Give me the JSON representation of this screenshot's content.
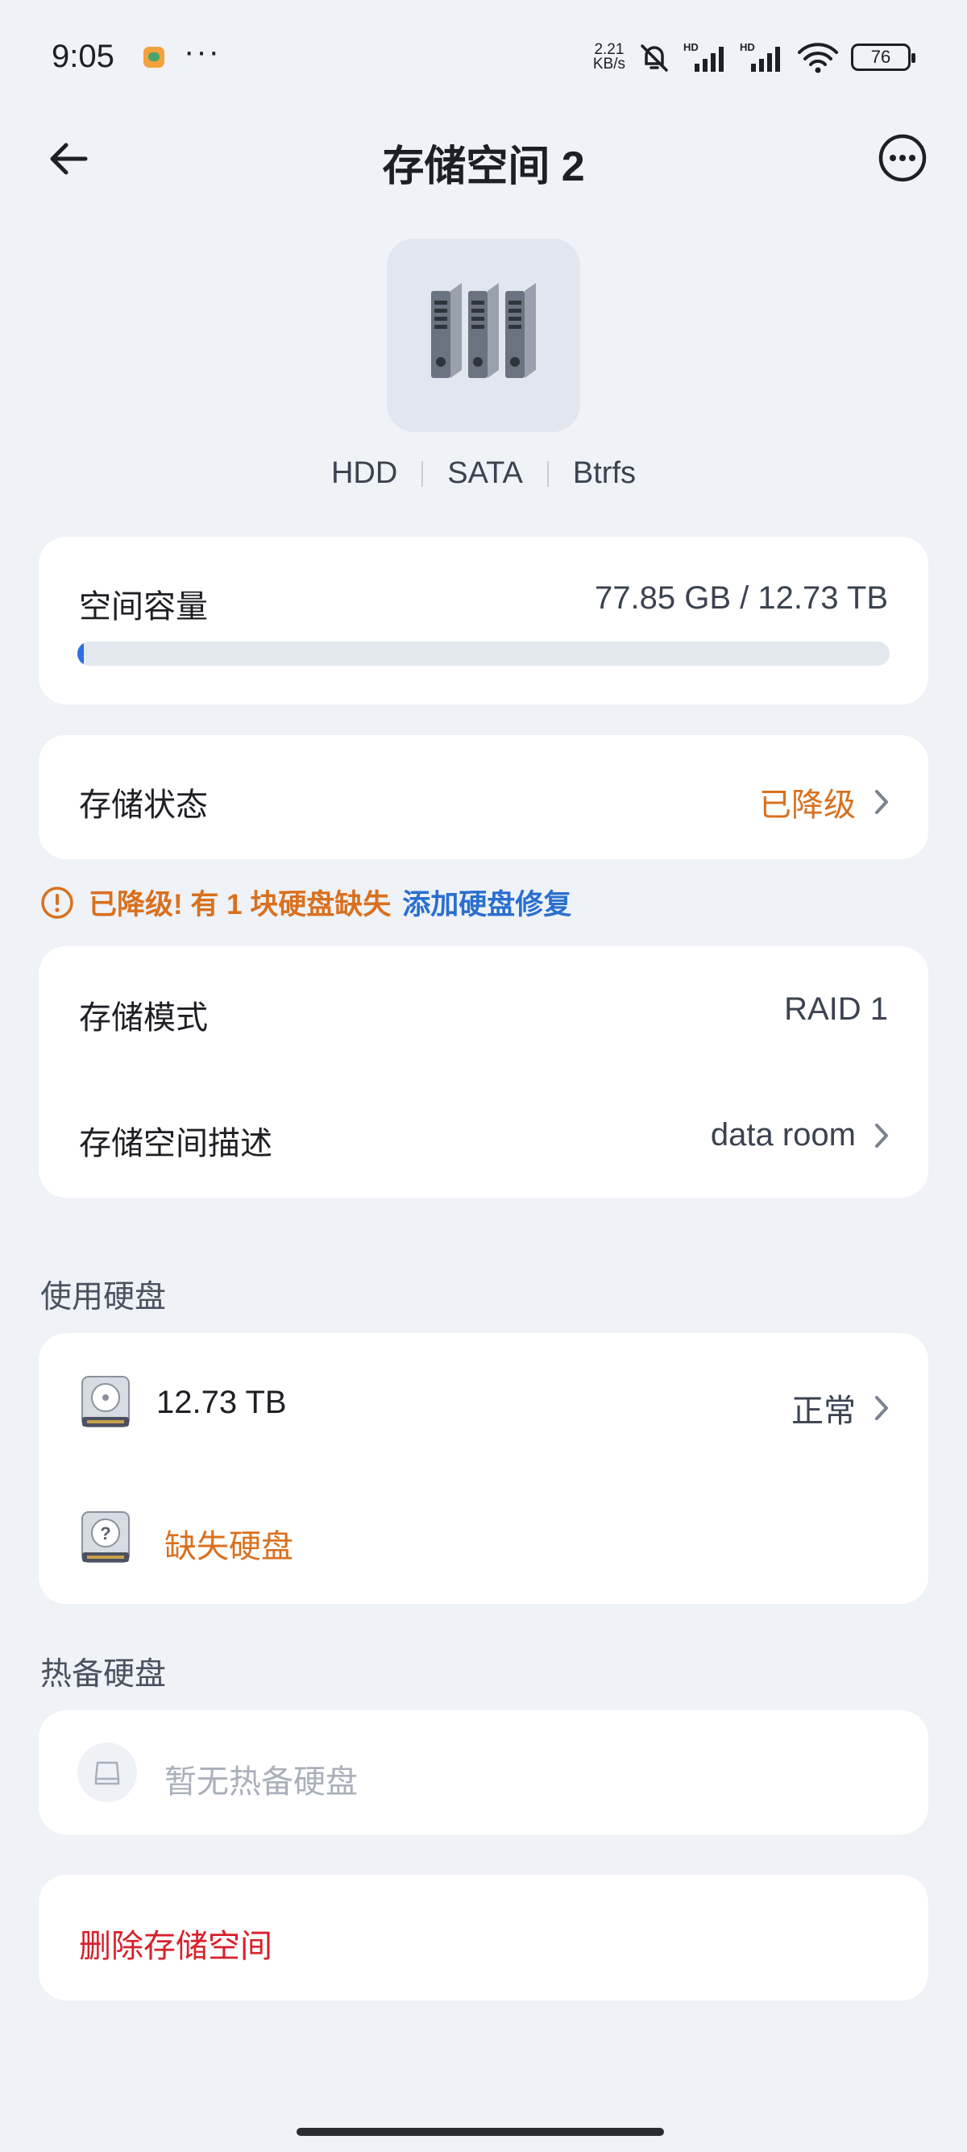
{
  "status_bar": {
    "time": "9:05",
    "dots": "···",
    "net_speed_value": "2.21",
    "net_speed_unit": "KB/s",
    "battery": "76",
    "icons": [
      "app-notification-icon",
      "mute-bell-icon",
      "hd-signal-icon",
      "hd-signal-icon",
      "wifi-icon",
      "battery-icon"
    ]
  },
  "header": {
    "title": "存储空间 2",
    "back_icon": "arrow-left-icon",
    "more_icon": "more-horizontal-icon"
  },
  "hero": {
    "icon": "drive-bay-icon",
    "tags": [
      "HDD",
      "SATA",
      "Btrfs"
    ]
  },
  "capacity": {
    "label": "空间容量",
    "value": "77.85 GB / 12.73 TB",
    "used_fraction": 0.006
  },
  "status": {
    "label": "存储状态",
    "value": "已降级"
  },
  "warning": {
    "text": "已降级! 有 1 块硬盘缺失",
    "link": "添加硬盘修复"
  },
  "mode": {
    "label": "存储模式",
    "value": "RAID 1"
  },
  "description": {
    "label": "存储空间描述",
    "value": "data room"
  },
  "disks_section": {
    "title": "使用硬盘",
    "disks": [
      {
        "name": "12.73 TB",
        "status": "正常",
        "icon": "hard-disk-icon"
      },
      {
        "name": "缺失硬盘",
        "status": "",
        "icon": "missing-disk-icon"
      }
    ]
  },
  "hot_spare_section": {
    "title": "热备硬盘",
    "empty_text": "暂无热备硬盘",
    "icon": "disk-outline-icon"
  },
  "delete": {
    "label": "删除存储空间"
  },
  "colors": {
    "background": "#eff2f7",
    "card": "#ffffff",
    "warning": "#d9701e",
    "link": "#2a6fcf",
    "danger": "#d8202b",
    "progress": "#2d6fe0"
  }
}
